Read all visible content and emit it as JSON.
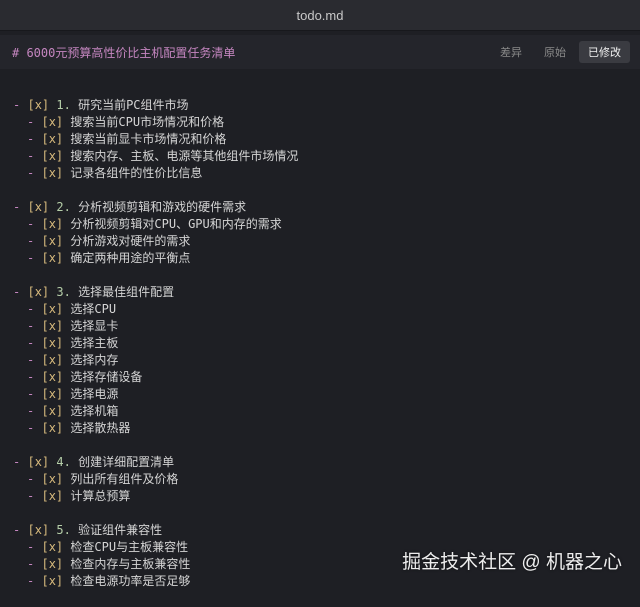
{
  "window": {
    "title": "todo.md"
  },
  "toolbar": {
    "heading": "# 6000元预算高性价比主机配置任务清单",
    "tabs": [
      {
        "label": "差异",
        "active": false
      },
      {
        "label": "原始",
        "active": false
      },
      {
        "label": "已修改",
        "active": true
      }
    ]
  },
  "sections": [
    {
      "checkbox": "[x]",
      "number": "1.",
      "title": "研究当前PC组件市场",
      "items": [
        "搜索当前CPU市场情况和价格",
        "搜索当前显卡市场情况和价格",
        "搜索内存、主板、电源等其他组件市场情况",
        "记录各组件的性价比信息"
      ]
    },
    {
      "checkbox": "[x]",
      "number": "2.",
      "title": "分析视频剪辑和游戏的硬件需求",
      "items": [
        "分析视频剪辑对CPU、GPU和内存的需求",
        "分析游戏对硬件的需求",
        "确定两种用途的平衡点"
      ]
    },
    {
      "checkbox": "[x]",
      "number": "3.",
      "title": "选择最佳组件配置",
      "items": [
        "选择CPU",
        "选择显卡",
        "选择主板",
        "选择内存",
        "选择存储设备",
        "选择电源",
        "选择机箱",
        "选择散热器"
      ]
    },
    {
      "checkbox": "[x]",
      "number": "4.",
      "title": "创建详细配置清单",
      "items": [
        "列出所有组件及价格",
        "计算总预算"
      ]
    },
    {
      "checkbox": "[x]",
      "number": "5.",
      "title": "验证组件兼容性",
      "items": [
        "检查CPU与主板兼容性",
        "检查内存与主板兼容性",
        "检查电源功率是否足够"
      ]
    }
  ],
  "watermark": "掘金技术社区 @ 机器之心"
}
